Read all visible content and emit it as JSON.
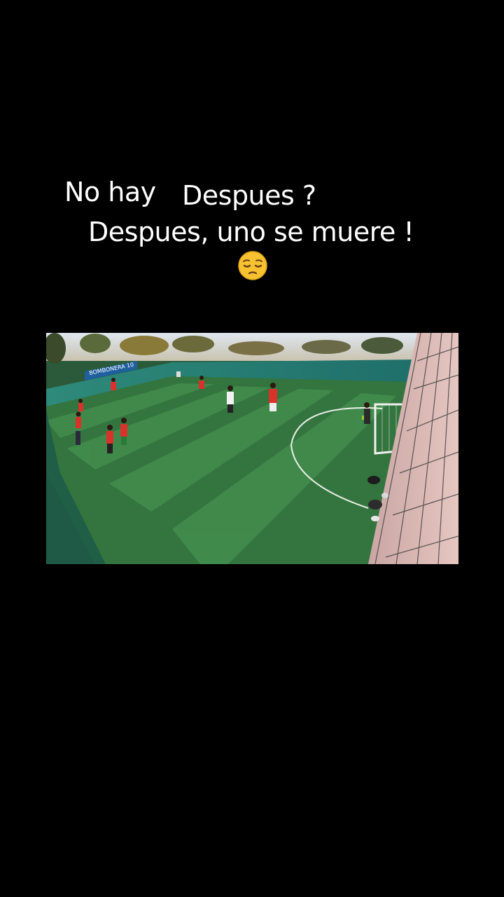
{
  "overlay_text": {
    "line1_left": "No hay",
    "line1_right": "Despues ?",
    "line2": "Despues, uno se muere !",
    "emoji": "pensive-face-emoji"
  },
  "video": {
    "banner_text": "BOMBONERA 10",
    "scene": "five-a-side football pitch from elevated corner camera"
  },
  "colors": {
    "background": "#000000",
    "text": "#ffffff",
    "pitch_light": "#3f8a4a",
    "pitch_dark": "#2c6b39",
    "team_red": "#d9322b",
    "banner_blue": "#1f5f9e"
  }
}
